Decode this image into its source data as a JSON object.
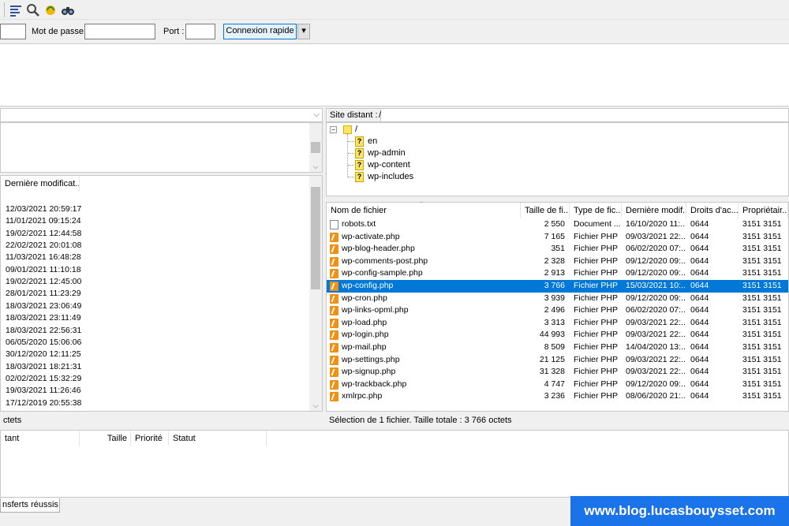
{
  "toolbar": {
    "icons": [
      "filter-icon",
      "search-files-icon",
      "sync-browsing-icon",
      "find-binoculars-icon"
    ]
  },
  "quickconnect": {
    "password_label": "Mot de passe :",
    "port_label": "Port :",
    "connect_label": "Connexion rapide",
    "dropdown_arrow": "▾",
    "password_value": "",
    "port_value": ""
  },
  "local": {
    "col_modified": "Dernière modificat...",
    "dates": [
      "12/03/2021 20:59:17",
      "11/01/2021 09:15:24",
      "19/02/2021 12:44:58",
      "22/02/2021 20:01:08",
      "11/03/2021 16:48:28",
      "09/01/2021 11:10:18",
      "19/02/2021 12:45:00",
      "28/01/2021 11:23:29",
      "18/03/2021 23:06:49",
      "18/03/2021 23:11:49",
      "18/03/2021 22:56:31",
      "06/05/2020 15:06:06",
      "30/12/2020 12:11:25",
      "18/03/2021 18:21:31",
      "02/02/2021 15:32:29",
      "19/03/2021 11:26:46",
      "17/12/2019 20:55:38"
    ],
    "status_fragment": "ctets"
  },
  "remote": {
    "site_label": "Site distant :",
    "path": "/",
    "tree": {
      "root": "/",
      "children": [
        "en",
        "wp-admin",
        "wp-content",
        "wp-includes"
      ]
    },
    "columns": [
      "Nom de fichier",
      "Taille de fi...",
      "Type de fic...",
      "Dernière modif...",
      "Droits d'ac...",
      "Propriétair..."
    ],
    "files": [
      {
        "name": "robots.txt",
        "size": "2 550",
        "type": "Document ...",
        "modified": "16/10/2020 11:...",
        "perms": "0644",
        "owner": "3151 3151",
        "icon": "txt"
      },
      {
        "name": "wp-activate.php",
        "size": "7 165",
        "type": "Fichier PHP",
        "modified": "09/03/2021 22:...",
        "perms": "0644",
        "owner": "3151 3151",
        "icon": "php"
      },
      {
        "name": "wp-blog-header.php",
        "size": "351",
        "type": "Fichier PHP",
        "modified": "06/02/2020 07:...",
        "perms": "0644",
        "owner": "3151 3151",
        "icon": "php"
      },
      {
        "name": "wp-comments-post.php",
        "size": "2 328",
        "type": "Fichier PHP",
        "modified": "09/12/2020 09:...",
        "perms": "0644",
        "owner": "3151 3151",
        "icon": "php"
      },
      {
        "name": "wp-config-sample.php",
        "size": "2 913",
        "type": "Fichier PHP",
        "modified": "09/12/2020 09:...",
        "perms": "0644",
        "owner": "3151 3151",
        "icon": "php"
      },
      {
        "name": "wp-config.php",
        "size": "3 766",
        "type": "Fichier PHP",
        "modified": "15/03/2021 10:...",
        "perms": "0644",
        "owner": "3151 3151",
        "icon": "php",
        "selected": true
      },
      {
        "name": "wp-cron.php",
        "size": "3 939",
        "type": "Fichier PHP",
        "modified": "09/12/2020 09:...",
        "perms": "0644",
        "owner": "3151 3151",
        "icon": "php"
      },
      {
        "name": "wp-links-opml.php",
        "size": "2 496",
        "type": "Fichier PHP",
        "modified": "06/02/2020 07:...",
        "perms": "0644",
        "owner": "3151 3151",
        "icon": "php"
      },
      {
        "name": "wp-load.php",
        "size": "3 313",
        "type": "Fichier PHP",
        "modified": "09/03/2021 22:...",
        "perms": "0644",
        "owner": "3151 3151",
        "icon": "php"
      },
      {
        "name": "wp-login.php",
        "size": "44 993",
        "type": "Fichier PHP",
        "modified": "09/03/2021 22:...",
        "perms": "0644",
        "owner": "3151 3151",
        "icon": "php"
      },
      {
        "name": "wp-mail.php",
        "size": "8 509",
        "type": "Fichier PHP",
        "modified": "14/04/2020 13:...",
        "perms": "0644",
        "owner": "3151 3151",
        "icon": "php"
      },
      {
        "name": "wp-settings.php",
        "size": "21 125",
        "type": "Fichier PHP",
        "modified": "09/03/2021 22:...",
        "perms": "0644",
        "owner": "3151 3151",
        "icon": "php"
      },
      {
        "name": "wp-signup.php",
        "size": "31 328",
        "type": "Fichier PHP",
        "modified": "09/03/2021 22:...",
        "perms": "0644",
        "owner": "3151 3151",
        "icon": "php"
      },
      {
        "name": "wp-trackback.php",
        "size": "4 747",
        "type": "Fichier PHP",
        "modified": "09/12/2020 09:...",
        "perms": "0644",
        "owner": "3151 3151",
        "icon": "php"
      },
      {
        "name": "xmlrpc.php",
        "size": "3 236",
        "type": "Fichier PHP",
        "modified": "08/06/2020 21:...",
        "perms": "0644",
        "owner": "3151 3151",
        "icon": "php"
      }
    ],
    "status": "Sélection de 1 fichier. Taille totale : 3 766 octets"
  },
  "queue": {
    "col_remote": "tant",
    "col_size": "Taille",
    "col_priority": "Priorité",
    "col_status": "Statut",
    "tab_label": "nsferts réussis"
  },
  "brand": {
    "url": "www.blog.lucasbouysset.com",
    "color": "#1a73e8"
  },
  "colors": {
    "selection": "#0078d7",
    "php_icon": "#f29111",
    "folder": "#ffe36b"
  }
}
